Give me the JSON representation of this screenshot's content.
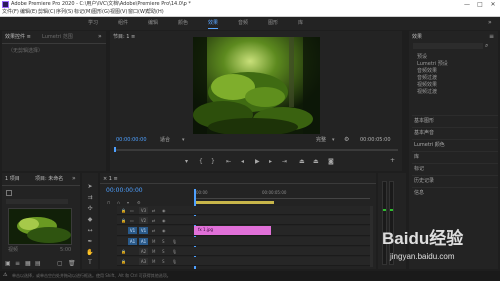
{
  "titlebar": {
    "title": "Adobe Premiere Pro 2020 - C:\\用户\\IVC\\文档\\Adobe\\Premiere Pro\\14.0\\p *",
    "minimize": "—",
    "maximize": "□",
    "close": "✕"
  },
  "menu": [
    "文件(F)",
    "编辑(E)",
    "剪辑(C)",
    "序列(S)",
    "标记(M)",
    "图形(G)",
    "视图(V)",
    "窗口(W)",
    "帮助(H)"
  ],
  "workspaces": [
    {
      "label": "学习",
      "active": false
    },
    {
      "label": "组件",
      "active": false
    },
    {
      "label": "编辑",
      "active": false
    },
    {
      "label": "颜色",
      "active": false
    },
    {
      "label": "效果",
      "active": true
    },
    {
      "label": "音频",
      "active": false
    },
    {
      "label": "图形",
      "active": false
    },
    {
      "label": "库",
      "active": false
    }
  ],
  "source_panel": {
    "tabs": [
      "效果控件 ≡",
      "Lumetri 范围"
    ],
    "no_clip": "（无剪辑选择）"
  },
  "program_monitor": {
    "tab": "节目: 1 ≡",
    "timecode_left": "00:00:00:00",
    "fit": "适合",
    "full": "完整",
    "timecode_right": "00:00:05:00"
  },
  "project_panel": {
    "tabs": [
      "项目: 未命名",
      "媒体浏览器",
      "库"
    ],
    "tab_short": "1 项目",
    "clip_name": "视频",
    "clip_duration": "5:00"
  },
  "timeline": {
    "tab": "× 1 ≡",
    "timecode": "00:00:00:00",
    "ruler_start": "00:00",
    "ruler_mid": "00:00:05:00",
    "tracks_video": [
      "V3",
      "V2",
      "V1"
    ],
    "tracks_audio": [
      "A1",
      "A2",
      "A3"
    ],
    "clip_label": "fx 1.jpg",
    "track_controls": [
      "M",
      "S"
    ]
  },
  "effects_panel": {
    "title": "效果",
    "folders": [
      "预设",
      "Lumetri 预设",
      "音频效果",
      "音频过渡",
      "视频效果",
      "视频过渡"
    ],
    "sections": [
      "基本图形",
      "基本声音",
      "Lumetri 颜色",
      "库",
      "标记",
      "历史记录",
      "信息"
    ]
  },
  "statusbar": {
    "text": "单击以选择，或单击空白处并拖动以进行框选。使用 Shift、Alt 和 Ctrl 可获得其他选项。"
  },
  "watermark": {
    "main": "Baidu经验",
    "url": "jingyan.baidu.com"
  },
  "colors": {
    "accent_blue": "#4ea0ff",
    "clip_pink": "#e070d8",
    "work_area_yellow": "#c8b64a",
    "meter_green": "#2fbf2f"
  }
}
